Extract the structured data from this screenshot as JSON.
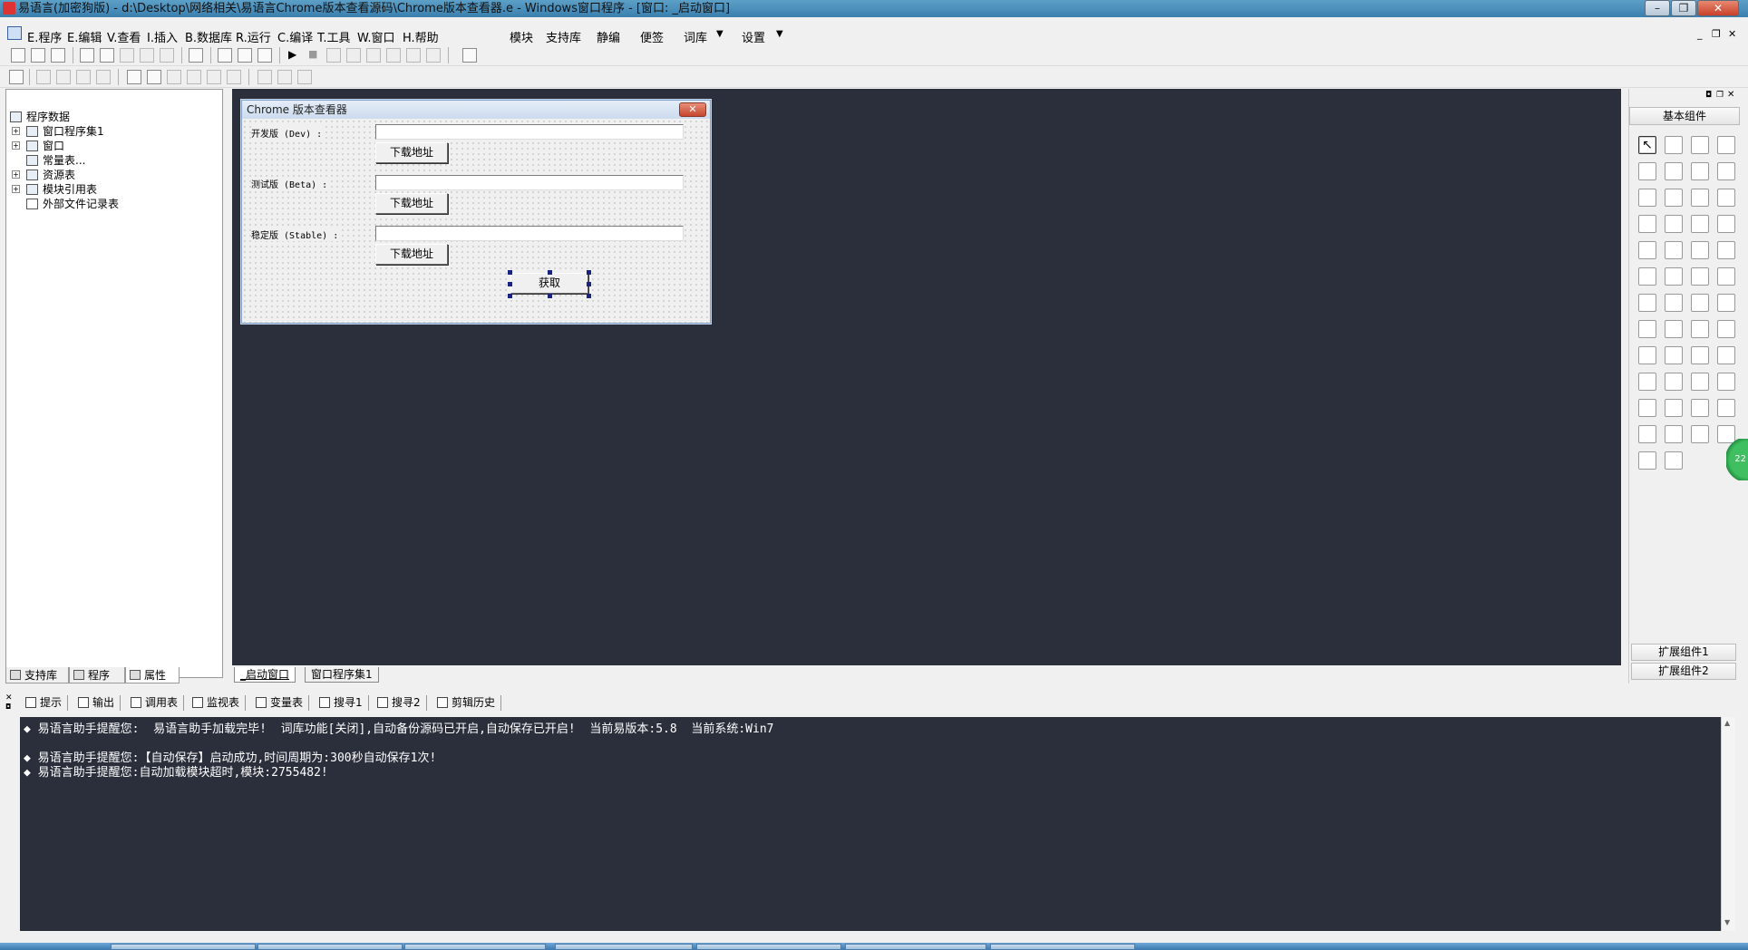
{
  "window": {
    "title": "易语言(加密狗版) - d:\\Desktop\\网络相关\\易语言Chrome版本查看源码\\Chrome版本查看器.e - Windows窗口程序 - [窗口: _启动窗口]",
    "minimize": "–",
    "restore": "❐",
    "close": "✕"
  },
  "menu": {
    "program": "E.程序",
    "edit": "E.编辑",
    "view": "V.查看",
    "insert": "I.插入",
    "database": "B.数据库",
    "run": "R.运行",
    "compile": "C.编译",
    "tools": "T.工具",
    "window": "W.窗口",
    "help": "H.帮助",
    "module": "模块",
    "support_lib": "支持库",
    "static": "静编",
    "note": "便签",
    "ciku": "词库",
    "settings": "设置"
  },
  "left_panel": {
    "tree": [
      {
        "label": "程序数据",
        "expander": ""
      },
      {
        "label": "窗口程序集1",
        "expander": "+"
      },
      {
        "label": "窗口",
        "expander": "+"
      },
      {
        "label": "常量表...",
        "expander": ""
      },
      {
        "label": "资源表",
        "expander": "+"
      },
      {
        "label": "模块引用表",
        "expander": "+"
      },
      {
        "label": "外部文件记录表",
        "expander": ""
      }
    ],
    "tabs": {
      "support": "支持库",
      "program": "程序",
      "property": "属性"
    }
  },
  "form": {
    "title": "Chrome 版本查看器",
    "dev_label": "开发版 (Dev) :",
    "beta_label": "测试版 (Beta) :",
    "stable_label": "稳定版 (Stable) :",
    "download_label": "下载地址",
    "fetch_label": "获取",
    "dev_value": "",
    "beta_value": "",
    "stable_value": ""
  },
  "design_tabs": {
    "startup": "_启动窗口",
    "assembly": "窗口程序集1"
  },
  "right_panel": {
    "header": "基本组件",
    "ext1": "扩展组件1",
    "ext2": "扩展组件2",
    "component_count": 50
  },
  "output_tabs": {
    "tip": "提示",
    "output": "输出",
    "callstack": "调用表",
    "watch": "监视表",
    "vars": "变量表",
    "search1": "搜寻1",
    "search2": "搜寻2",
    "clip": "剪辑历史"
  },
  "output": {
    "lines": [
      "◆ 易语言助手提醒您:  易语言助手加载完毕!  词库功能[关闭],自动备份源码已开启,自动保存已开启!  当前易版本:5.8  当前系统:Win7",
      "◆ 易语言助手提醒您:【自动保存】启动成功,时间周期为:300秒自动保存1次!",
      "◆ 易语言助手提醒您:自动加载模块超时,模块:2755482!"
    ]
  },
  "side_badge": "22"
}
